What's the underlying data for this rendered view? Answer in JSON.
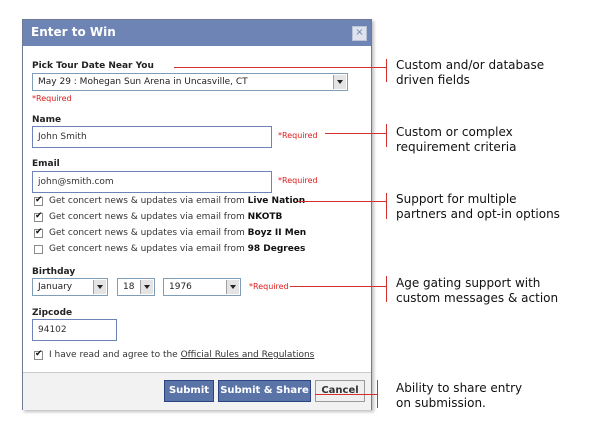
{
  "dialog": {
    "title": "Enter to Win",
    "close_glyph": "×",
    "tour": {
      "label": "Pick Tour Date Near You",
      "selected": "May 29 : Mohegan Sun Arena in Uncasville, CT",
      "required": "*Required"
    },
    "name": {
      "label": "Name",
      "value": "John Smith",
      "required": "*Required"
    },
    "email": {
      "label": "Email",
      "value": "john@smith.com",
      "required": "*Required"
    },
    "optins": [
      {
        "prefix": "Get concert news & updates via email from ",
        "partner": "Live Nation",
        "checked": true
      },
      {
        "prefix": "Get concert news & updates via email from ",
        "partner": "NKOTB",
        "checked": true
      },
      {
        "prefix": "Get concert news & updates via email from ",
        "partner": "Boyz II Men",
        "checked": true
      },
      {
        "prefix": "Get concert news & updates via email from ",
        "partner": "98 Degrees",
        "checked": false
      }
    ],
    "birthday": {
      "label": "Birthday",
      "month": "January",
      "day": "18",
      "year": "1976",
      "required": "*Required"
    },
    "zipcode": {
      "label": "Zipcode",
      "value": "94102"
    },
    "agree": {
      "text": "I have read and agree to the ",
      "link": "Official Rules and Regulations",
      "checked": true
    },
    "buttons": {
      "submit": "Submit",
      "submit_share": "Submit & Share",
      "cancel": "Cancel"
    }
  },
  "callouts": [
    {
      "line1": "Custom and/or database",
      "line2": "driven fields"
    },
    {
      "line1": "Custom or complex",
      "line2": "requirement criteria"
    },
    {
      "line1": "Support for multiple",
      "line2": "partners and opt-in options"
    },
    {
      "line1": "Age gating support with",
      "line2": "custom messages & action"
    },
    {
      "line1": "Ability to share entry",
      "line2": "on submission."
    }
  ],
  "colors": {
    "titlebar": "#6d84b4",
    "button_blue": "#5b74a8",
    "required_red": "#dd1c1c",
    "callout_line": "#d43030"
  }
}
